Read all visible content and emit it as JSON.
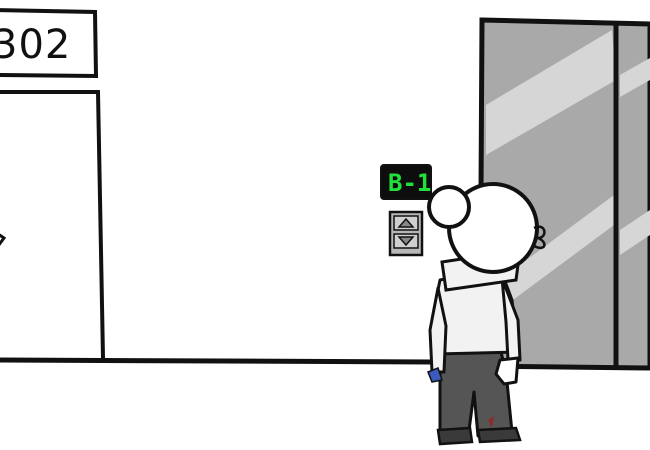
{
  "scene": {
    "room_sign": {
      "number": "302"
    },
    "floor_indicator": {
      "label": "B-1",
      "color": "#22e03a"
    },
    "call_panel": {
      "up_icon": "triangle-up-icon",
      "down_icon": "triangle-down-icon"
    },
    "colors": {
      "wall": "#ffffff",
      "outline": "#111111",
      "elevator_door": "#a9a9a9",
      "door_highlight": "#d6d6d6",
      "pants": "#555555",
      "shirt": "#f2f2f2"
    }
  }
}
